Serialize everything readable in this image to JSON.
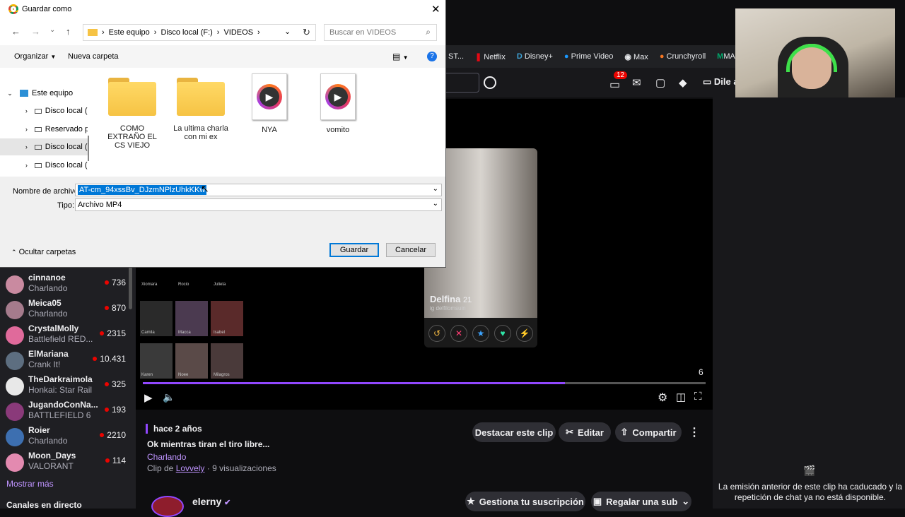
{
  "dialog": {
    "title": "Guardar como",
    "breadcrumb": [
      "Este equipo",
      "Disco local (F:)",
      "VIDEOS"
    ],
    "search_placeholder": "Buscar en VIDEOS",
    "organize_label": "Organizar",
    "new_folder_label": "Nueva carpeta",
    "tree": [
      "Este equipo",
      "Disco local (C:)",
      "Reservado para",
      "Disco local (F:)",
      "Disco local (G:)"
    ],
    "files": [
      {
        "name": "COMO EXTRAÑO EL CS VIEJO",
        "type": "folder"
      },
      {
        "name": "La ultima charla con mi ex",
        "type": "folder"
      },
      {
        "name": "NYA",
        "type": "video"
      },
      {
        "name": "vomito",
        "type": "video"
      }
    ],
    "filename_label": "Nombre de archivo:",
    "filename_value": "AT-cm_94xssBv_DJzmNPlzUhkKKw",
    "type_label": "Tipo:",
    "type_value": "Archivo MP4",
    "hide_folders_label": "Ocultar carpetas",
    "save_label": "Guardar",
    "cancel_label": "Cancelar"
  },
  "bookmarks": [
    "ST...",
    "Netflix",
    "Disney+",
    "Prime Video",
    "Max",
    "Crunchyroll",
    "MA"
  ],
  "topbar": {
    "notifications": "12",
    "dile": "Dile a"
  },
  "sidebar": {
    "channels": [
      {
        "name": "cinnanoe",
        "game": "Charlando",
        "viewers": "736",
        "color": "#c98aa0"
      },
      {
        "name": "Meica05",
        "game": "Charlando",
        "viewers": "870",
        "color": "#a57b8c"
      },
      {
        "name": "CrystalMolly",
        "game": "Battlefield RED...",
        "viewers": "2315",
        "color": "#e06a9b"
      },
      {
        "name": "ElMariana",
        "game": "Crank It!",
        "viewers": "10.431",
        "color": "#5d6e80"
      },
      {
        "name": "TheDarkraimola",
        "game": "Honkai: Star Rail",
        "viewers": "325",
        "color": "#e8e8e8"
      },
      {
        "name": "JugandoConNa...",
        "game": "BATTLEFIELD 6",
        "viewers": "193",
        "color": "#8a3a7a"
      },
      {
        "name": "Roier",
        "game": "Charlando",
        "viewers": "2210",
        "color": "#3d6fb0"
      },
      {
        "name": "Moon_Days",
        "game": "VALORANT",
        "viewers": "114",
        "color": "#e38ab0"
      }
    ],
    "show_more": "Mostrar más",
    "live_channels": "Canales en directo"
  },
  "player": {
    "profile_name": "Delfina",
    "profile_age": "21",
    "profile_handle": "ig delfilomsuin",
    "grid_names": [
      "Xiomara",
      "Rocio",
      "Julieta",
      "Camila",
      "Macca",
      "Isabel",
      "Karen",
      "Noee",
      "Milagros"
    ],
    "counter": "6",
    "progress": 0.75
  },
  "clip": {
    "age": "hace 2 años",
    "title": "Ok mientras tiran el tiro libre...",
    "category": "Charlando",
    "clip_by_prefix": "Clip de",
    "clipper": "Lovvely",
    "views": "· 9 visualizaciones",
    "highlight_label": "Destacar este clip",
    "edit_label": "Editar",
    "share_label": "Compartir",
    "streamer": "elerny",
    "subscription_label": "Gestiona tu suscripción",
    "gift_label": "Regalar una sub"
  },
  "chat": {
    "unavailable": "La emisión anterior de este clip ha caducado y la repetición de chat ya no está disponible."
  }
}
